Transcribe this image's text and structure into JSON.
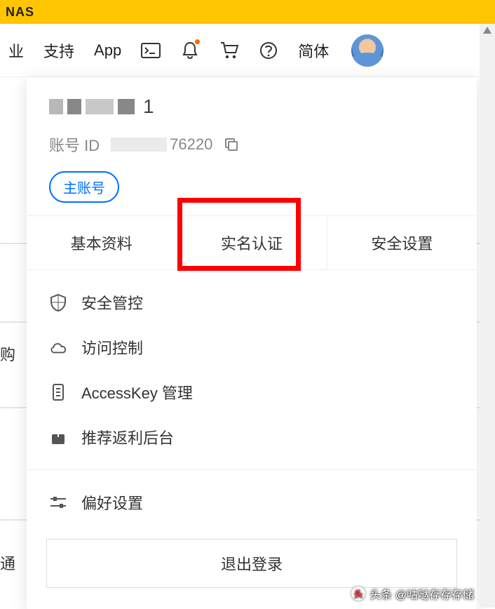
{
  "top_bar": {
    "title_fragment": "NAS"
  },
  "header": {
    "nav_item_1": "业",
    "nav_item_2": "支持",
    "nav_item_3": "App",
    "lang": "简体"
  },
  "dropdown": {
    "username_suffix": "1",
    "account_label": "账号 ID",
    "account_id_suffix": "76220",
    "badge": "主账号",
    "tabs": {
      "basic": "基本资料",
      "realname": "实名认证",
      "security": "安全设置"
    },
    "menu": {
      "security_control": "安全管控",
      "access_control": "访问控制",
      "accesskey": "AccessKey 管理",
      "referral": "推荐返利后台",
      "preference": "偏好设置"
    },
    "logout": "退出登录"
  },
  "background": {
    "text1": "购",
    "text2": "通"
  },
  "watermark": {
    "text": "头条 @咕哒存存存储"
  }
}
